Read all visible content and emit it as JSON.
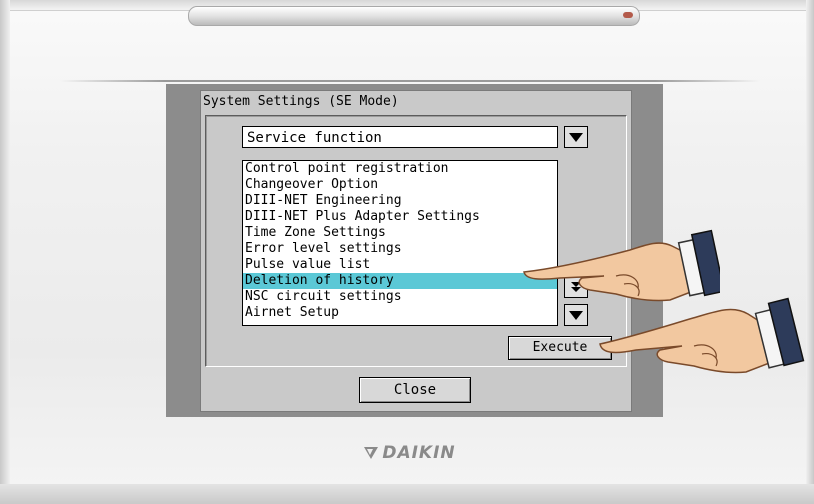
{
  "dialog": {
    "title": "System Settings (SE Mode)"
  },
  "combo": {
    "value": "Service function",
    "icon": "chevron-down-icon"
  },
  "list": {
    "items": [
      "Control point registration",
      "Changeover Option",
      "DIII-NET Engineering",
      "DIII-NET Plus Adapter Settings",
      "Time Zone Settings",
      "Error level settings",
      "Pulse value list",
      "Deletion of history",
      "NSC circuit settings",
      "Airnet Setup"
    ],
    "selected_index": 7,
    "selected_color": "#5bc8d6"
  },
  "buttons": {
    "execute": "Execute",
    "close": "Close"
  },
  "brand": {
    "name": "DAIKIN"
  }
}
